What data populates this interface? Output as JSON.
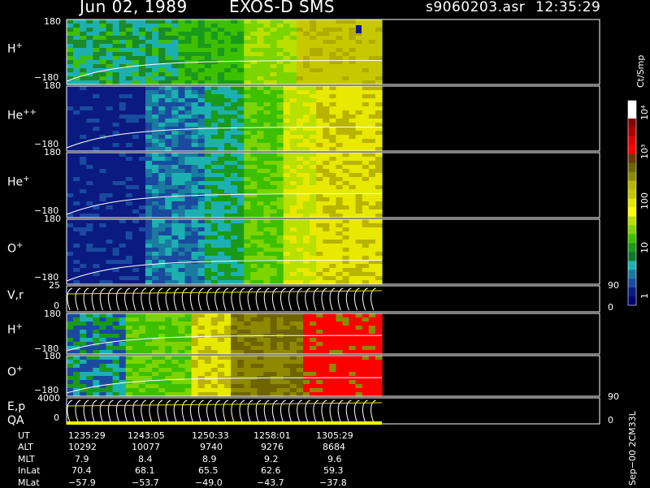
{
  "header": {
    "date": "Jun 02, 1989",
    "instrument": "EXOS-D SMS",
    "file": "s9060203.asr",
    "time": "12:35:29"
  },
  "colorbar": {
    "unit_label": "Ct/Smp",
    "ticks": [
      "10⁴",
      "10³",
      "100",
      "10",
      "1"
    ],
    "colors": [
      "#ffffff",
      "#ffffff",
      "#8b0000",
      "#b00000",
      "#e00000",
      "#ff0000",
      "#6b3a00",
      "#6e6400",
      "#8e8a00",
      "#b8b400",
      "#c8c800",
      "#e8e800",
      "#ffff00",
      "#b8e000",
      "#7cd400",
      "#3cc000",
      "#1a9a1a",
      "#0a7a2a",
      "#1cb0b0",
      "#1a7aa0",
      "#1a4aa0",
      "#0a1a80",
      "#000070"
    ]
  },
  "panels": [
    {
      "id": "h",
      "label": "H",
      "sup": "+",
      "top_tick": "180",
      "bottom_tick": "−180"
    },
    {
      "id": "hepp",
      "label": "He",
      "sup": "++",
      "top_tick": "180",
      "bottom_tick": "−180"
    },
    {
      "id": "hep",
      "label": "He",
      "sup": "+",
      "top_tick": "180",
      "bottom_tick": "−180"
    },
    {
      "id": "o",
      "label": "O",
      "sup": "+",
      "top_tick": "180",
      "bottom_tick": "−180"
    },
    {
      "id": "vr",
      "label": "V,r",
      "sup": "",
      "top_tick": "25",
      "bottom_tick": "0",
      "right_top": "90",
      "right_bottom": "0"
    },
    {
      "id": "h2",
      "label": "H",
      "sup": "+",
      "top_tick": "180",
      "bottom_tick": "−180"
    },
    {
      "id": "o2",
      "label": "O",
      "sup": "+",
      "top_tick": "180",
      "bottom_tick": "−180"
    },
    {
      "id": "ep",
      "label": "E,p",
      "label2": "QA",
      "sup": "",
      "top_tick": "4000",
      "bottom_tick": "0",
      "right_top": "90",
      "right_bottom": "0"
    }
  ],
  "footer": {
    "row_labels": [
      "UT",
      "ALT",
      "MLT",
      "InLat",
      "MLat"
    ],
    "columns": [
      [
        "1235:29",
        "10292",
        "7.9",
        "70.4",
        "−57.9"
      ],
      [
        "1243:05",
        "10077",
        "8.4",
        "68.1",
        "−53.7"
      ],
      [
        "1250:33",
        "9740",
        "8.9",
        "65.5",
        "−49.0"
      ],
      [
        "1258:01",
        "9276",
        "9.2",
        "62.6",
        "−43.7"
      ],
      [
        "1305:29",
        "8684",
        "9.6",
        "59.3",
        "−37.8"
      ]
    ]
  },
  "side_note": "Sep−00  2CM33L",
  "chart_data": {
    "type": "heatmap",
    "title": "Jun 02, 1989   EXOS-D SMS",
    "x_ticks": [
      "1235:29",
      "1243:05",
      "1250:33",
      "1258:01",
      "1305:29"
    ],
    "colorbar_label": "Ct/Smp",
    "colorbar_ticks": [
      "1",
      "10",
      "100",
      "10³",
      "10⁴"
    ],
    "series": [
      {
        "name": "H+",
        "ylim": [
          -180,
          180
        ]
      },
      {
        "name": "He++",
        "ylim": [
          -180,
          180
        ]
      },
      {
        "name": "He+",
        "ylim": [
          -180,
          180
        ]
      },
      {
        "name": "O+",
        "ylim": [
          -180,
          180
        ]
      },
      {
        "name": "V,r",
        "ylim": [
          0,
          25
        ]
      },
      {
        "name": "H+",
        "ylim": [
          -180,
          180
        ]
      },
      {
        "name": "O+",
        "ylim": [
          -180,
          180
        ]
      },
      {
        "name": "E,p",
        "ylim": [
          0,
          4000
        ]
      }
    ]
  }
}
